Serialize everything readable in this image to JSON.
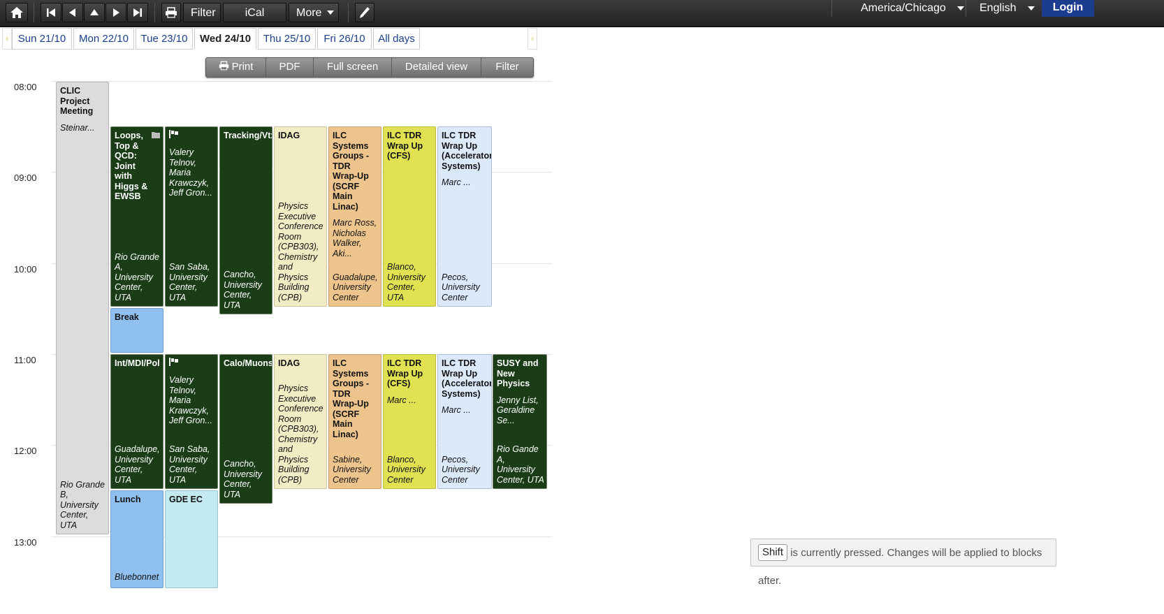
{
  "toolbar": {
    "home_icon": "home-icon",
    "first_icon": "first-page-icon",
    "prev_icon": "previous-icon",
    "up_icon": "up-icon",
    "next_icon": "next-icon",
    "last_icon": "last-page-icon",
    "print_icon": "printer-icon",
    "filter_label": "Filter",
    "ical_label": "iCal export",
    "more_label": "More",
    "edit_icon": "pencil-icon",
    "timezone": "America/Chicago",
    "language": "English",
    "login_label": "Login"
  },
  "days": [
    {
      "label": "Sun 21/10",
      "active": false
    },
    {
      "label": "Mon 22/10",
      "active": false
    },
    {
      "label": "Tue 23/10",
      "active": false
    },
    {
      "label": "Wed 24/10",
      "active": true
    },
    {
      "label": "Thu 25/10",
      "active": false
    },
    {
      "label": "Fri 26/10",
      "active": false
    },
    {
      "label": "All days",
      "active": false
    }
  ],
  "view_toolbar": {
    "print": "Print",
    "pdf": "PDF",
    "full_screen": "Full screen",
    "detailed_view": "Detailed view",
    "filter": "Filter"
  },
  "hours": [
    "08:00",
    "09:00",
    "10:00",
    "11:00",
    "12:00",
    "13:00"
  ],
  "blocks": {
    "clic": {
      "title": "CLIC Project Meeting",
      "people": "Steinar...",
      "room": "Rio Grande B, University Center, UTA"
    },
    "loops": {
      "title": "Loops, Top & QCD: Joint with Higgs & EWSB",
      "room": "Rio Grande A, University Center, UTA"
    },
    "valery1": {
      "people": "Valery Telnov, Maria Krawczyk, Jeff Gron...",
      "room": "San Saba, University Center, UTA"
    },
    "tracking": {
      "title": "Tracking/Vtx",
      "room": "Cancho, University Center, UTA"
    },
    "idag1": {
      "title": "IDAG",
      "room": "Physics Executive Conference Room (CPB303), Chemistry and Physics Building (CPB)"
    },
    "ilcsys1": {
      "title": "ILC Systems Groups - TDR Wrap-Up (SCRF Main Linac)",
      "people": "Marc Ross, Nicholas Walker, Aki...",
      "room": "Guadalupe, University Center"
    },
    "ilccfs1": {
      "title": "ILC TDR Wrap Up (CFS)",
      "room": "Blanco, University Center, UTA"
    },
    "ilcacc1": {
      "title": "ILC TDR Wrap Up (Accelerator Systems)",
      "people": "Marc ...",
      "room": "Pecos, University Center"
    },
    "break": {
      "title": "Break"
    },
    "intmdi": {
      "title": "Int/MDI/Pol",
      "room": "Guadalupe, University Center, UTA"
    },
    "valery2": {
      "people": "Valery Telnov, Maria Krawczyk, Jeff Gron...",
      "room": "San Saba, University Center, UTA"
    },
    "calo": {
      "title": "Calo/Muons",
      "room": "Cancho, University Center, UTA"
    },
    "idag2": {
      "title": "IDAG",
      "room": "Physics Executive Conference Room (CPB303), Chemistry and Physics Building (CPB)"
    },
    "ilcsys2": {
      "title": "ILC Systems Groups - TDR Wrap-Up (SCRF Main Linac)",
      "room": "Sabine, University Center"
    },
    "ilccfs2": {
      "title": "ILC TDR Wrap Up (CFS)",
      "people": "Marc ...",
      "room": "Blanco, University Center"
    },
    "ilcacc2": {
      "title": "ILC TDR Wrap Up (Accelerator Systems)",
      "people": "Marc ...",
      "room": "Pecos, University Center"
    },
    "susy": {
      "title": "SUSY and New Physics",
      "people": "Jenny List, Geraldine Se...",
      "room": "Rio Gande A, University Center, UTA"
    },
    "lunch": {
      "title": "Lunch",
      "room": "Bluebonnet"
    },
    "gde": {
      "title": "GDE EC"
    }
  },
  "toast": {
    "key": "Shift",
    "message": "is currently pressed. Changes will be applied to blocks after."
  },
  "colors": {
    "session_dark": "#1a3d17",
    "gray": "#dcdcdc",
    "cream": "#f1ecc4",
    "orange": "#eec48d",
    "yellow": "#e0e252",
    "light_blue": "#dce9fa",
    "break_blue": "#8fc0f0",
    "cyan": "#c3eaf0",
    "login_blue": "#1c3d8f"
  }
}
